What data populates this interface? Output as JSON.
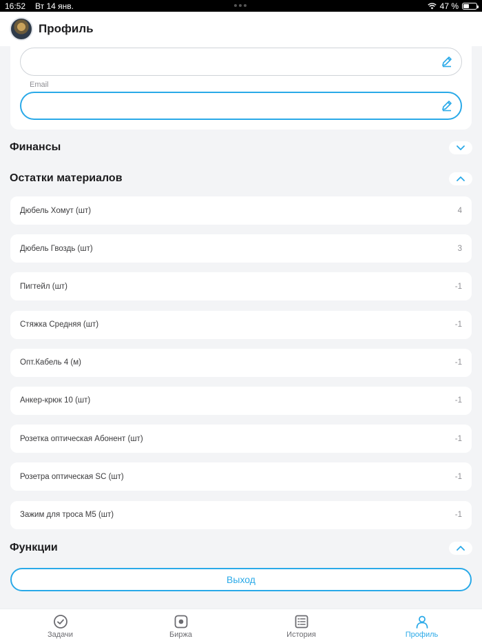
{
  "status_bar": {
    "time": "16:52",
    "date": "Вт 14 янв.",
    "battery": "47 %",
    "battery_level": 0.47
  },
  "header": {
    "title": "Профиль"
  },
  "profile": {
    "email_label": "Email",
    "field1_value": "",
    "email_value": ""
  },
  "sections": {
    "finance": "Финансы",
    "materials": "Остатки материалов",
    "functions": "Функции"
  },
  "materials": [
    {
      "name": "Дюбель Хомут (шт)",
      "qty": "4"
    },
    {
      "name": "Дюбель Гвоздь (шт)",
      "qty": "3"
    },
    {
      "name": "Пигтейл (шт)",
      "qty": "-1"
    },
    {
      "name": "Стяжка Средняя (шт)",
      "qty": "-1"
    },
    {
      "name": "Опт.Кабель 4 (м)",
      "qty": "-1"
    },
    {
      "name": "Анкер-крюк 10 (шт)",
      "qty": "-1"
    },
    {
      "name": "Розетка оптическая Абонент (шт)",
      "qty": "-1"
    },
    {
      "name": "Розетра оптическая SC (шт)",
      "qty": "-1"
    },
    {
      "name": "Зажим для троса M5 (шт)",
      "qty": "-1"
    }
  ],
  "logout_label": "Выход",
  "tabs": [
    {
      "label": "Задачи",
      "icon": "check-circle-icon"
    },
    {
      "label": "Биржа",
      "icon": "target-icon"
    },
    {
      "label": "История",
      "icon": "list-icon"
    },
    {
      "label": "Профиль",
      "icon": "person-icon"
    }
  ],
  "colors": {
    "accent": "#29a9e8",
    "background": "#f3f4f6"
  }
}
